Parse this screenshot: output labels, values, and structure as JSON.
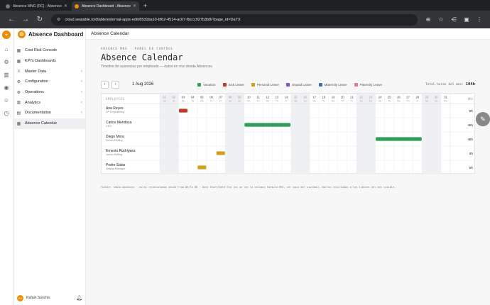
{
  "browser": {
    "tabs": [
      {
        "title": "Absence MNG (RC) - Absences",
        "active": false
      },
      {
        "title": "Absence Dashboard - Absence Ca",
        "active": true
      }
    ],
    "url": "cloud.seatable.io/dtable/external-apps-edit/8531ba10-bf62-4514-ac07-fbccc927b3b8/?page_id=DaTX"
  },
  "sidebar": {
    "brand": "Absence Dashboard",
    "items": [
      {
        "label": "Cost Risk Console",
        "icon": "grid-icon",
        "chevron": false,
        "active": false
      },
      {
        "label": "KPI's Dashboards",
        "icon": "grid-icon",
        "chevron": false,
        "active": false
      },
      {
        "label": "Master Data",
        "icon": "database-icon",
        "chevron": true,
        "active": false
      },
      {
        "label": "Configuration",
        "icon": "gear-icon",
        "chevron": true,
        "active": false
      },
      {
        "label": "Operations",
        "icon": "gear-icon",
        "chevron": true,
        "active": false
      },
      {
        "label": "Analytics",
        "icon": "chart-icon",
        "chevron": true,
        "active": false
      },
      {
        "label": "Documentation",
        "icon": "doc-icon",
        "chevron": true,
        "active": false
      },
      {
        "label": "Absence Calendar",
        "icon": "calendar-icon",
        "chevron": false,
        "active": true
      }
    ],
    "user": {
      "initials": "RS",
      "name": "Rafael Sanchis"
    }
  },
  "header": {
    "title": "Absence Calendar"
  },
  "page": {
    "overline": "ABSENCE MNG · PANEL DE CONTROL",
    "title": "Absence Calendar",
    "subtitle": "Timeline de ausencias por empleado — datos en vivo desde Absences",
    "current_date": "1 Aug 2026",
    "total_label": "Total horas del mes:",
    "total_value": "104h",
    "footnote": "Fuente: tabla Absences · horas recalculadas desde From DR/To DR · Date Start/Date End (no se lee la columna fórmula HRS, ver guía del sistema). Barras recortadas a los límites del mes visible.",
    "legend": [
      {
        "label": "Vacation",
        "color": "#2e9e5b"
      },
      {
        "label": "Sick Leave",
        "color": "#c0392b"
      },
      {
        "label": "Personal Leave",
        "color": "#d4a017"
      },
      {
        "label": "Unpaid Leave",
        "color": "#7e57c2"
      },
      {
        "label": "Maternity Leave",
        "color": "#3a6fb0"
      },
      {
        "label": "Paternity Leave",
        "color": "#e07a9a"
      }
    ]
  },
  "calendar": {
    "employee_header": "EMPLOYEES",
    "hrs_header": "HRS",
    "days": [
      {
        "d": "01",
        "w": "Sa",
        "weekend": true
      },
      {
        "d": "02",
        "w": "Su",
        "weekend": true
      },
      {
        "d": "03",
        "w": "Mo",
        "weekend": false
      },
      {
        "d": "04",
        "w": "Tu",
        "weekend": false
      },
      {
        "d": "05",
        "w": "We",
        "weekend": false
      },
      {
        "d": "06",
        "w": "Th",
        "weekend": false
      },
      {
        "d": "07",
        "w": "Fr",
        "weekend": false
      },
      {
        "d": "08",
        "w": "Sa",
        "weekend": true
      },
      {
        "d": "09",
        "w": "Su",
        "weekend": true
      },
      {
        "d": "10",
        "w": "Mo",
        "weekend": false
      },
      {
        "d": "11",
        "w": "Tu",
        "weekend": false
      },
      {
        "d": "12",
        "w": "We",
        "weekend": false
      },
      {
        "d": "13",
        "w": "Th",
        "weekend": false
      },
      {
        "d": "14",
        "w": "Fr",
        "weekend": false
      },
      {
        "d": "15",
        "w": "Sa",
        "weekend": true
      },
      {
        "d": "16",
        "w": "Su",
        "weekend": true
      },
      {
        "d": "17",
        "w": "Mo",
        "weekend": false
      },
      {
        "d": "18",
        "w": "Tu",
        "weekend": false
      },
      {
        "d": "19",
        "w": "We",
        "weekend": false
      },
      {
        "d": "20",
        "w": "Th",
        "weekend": false
      },
      {
        "d": "21",
        "w": "Fr",
        "weekend": false
      },
      {
        "d": "22",
        "w": "Sa",
        "weekend": true
      },
      {
        "d": "23",
        "w": "Su",
        "weekend": true
      },
      {
        "d": "24",
        "w": "Mo",
        "weekend": false
      },
      {
        "d": "25",
        "w": "Tu",
        "weekend": false
      },
      {
        "d": "26",
        "w": "We",
        "weekend": false
      },
      {
        "d": "27",
        "w": "Th",
        "weekend": false
      },
      {
        "d": "28",
        "w": "Fr",
        "weekend": false
      },
      {
        "d": "29",
        "w": "Sa",
        "weekend": true
      },
      {
        "d": "30",
        "w": "Su",
        "weekend": true
      },
      {
        "d": "31",
        "w": "Mo",
        "weekend": false
      }
    ],
    "employees": [
      {
        "name": "Ana Reyes",
        "role": "VP Engineering",
        "hrs": "8h",
        "absences": [
          {
            "start": 3,
            "end": 3,
            "type": "Sick Leave"
          }
        ]
      },
      {
        "name": "Carlos Mendoza",
        "role": "CEO",
        "hrs": "48h",
        "absences": [
          {
            "start": 10,
            "end": 14,
            "type": "Vacation"
          }
        ]
      },
      {
        "name": "Diego Mora",
        "role": "Senior Drilling",
        "hrs": "48h",
        "absences": [
          {
            "start": 24,
            "end": 28,
            "type": "Vacation"
          }
        ]
      },
      {
        "name": "Ernesto Rodríguez",
        "role": "Junior Drilling",
        "hrs": "8h",
        "absences": [
          {
            "start": 7,
            "end": 7,
            "type": "Personal Leave"
          }
        ]
      },
      {
        "name": "Pedro Salas",
        "role": "Drilling Manager",
        "hrs": "8h",
        "absences": [
          {
            "start": 5,
            "end": 5,
            "type": "Personal Leave"
          }
        ]
      }
    ]
  }
}
